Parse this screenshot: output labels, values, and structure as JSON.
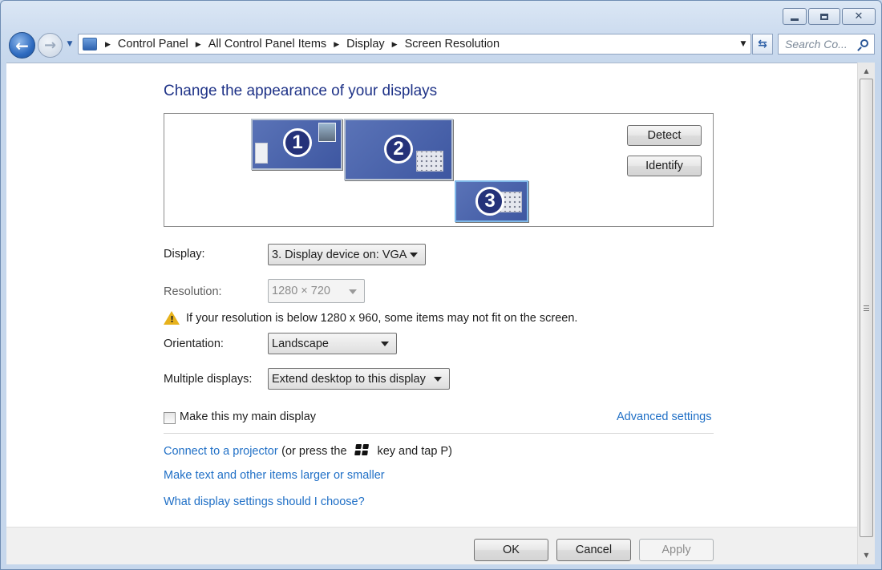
{
  "window": {
    "caption_buttons": {
      "minimize": "minimize-icon",
      "maximize": "maximize-icon",
      "close": "close-icon"
    }
  },
  "nav": {
    "breadcrumbs": [
      "Control Panel",
      "All Control Panel Items",
      "Display",
      "Screen Resolution"
    ],
    "search_placeholder": "Search Co..."
  },
  "main": {
    "title": "Change the appearance of your displays",
    "monitors": [
      {
        "number": "1",
        "selected": false
      },
      {
        "number": "2",
        "selected": false
      },
      {
        "number": "3",
        "selected": true
      }
    ],
    "detect_label": "Detect",
    "identify_label": "Identify",
    "display_label": "Display:",
    "display_value": "3. Display device on: VGA",
    "resolution_label": "Resolution:",
    "resolution_value": "1280 × 720",
    "warning_text": "If your resolution is below 1280 x 960, some items may not fit on the screen.",
    "orientation_label": "Orientation:",
    "orientation_value": "Landscape",
    "multiple_label": "Multiple displays:",
    "multiple_value": "Extend desktop to this display",
    "main_display_label": "Make this my main display",
    "main_display_checked": false,
    "advanced_link": "Advanced settings",
    "projector_link": "Connect to a projector",
    "projector_hint_pre": "(or press the",
    "projector_hint_post": "key and tap P)",
    "text_size_link": "Make text and other items larger or smaller",
    "help_link": "What display settings should I choose?"
  },
  "footer": {
    "ok_label": "OK",
    "cancel_label": "Cancel",
    "apply_label": "Apply"
  },
  "colors": {
    "link": "#1f6fc6",
    "title": "#1e3287",
    "monitor_fill": "#4a63aa"
  }
}
